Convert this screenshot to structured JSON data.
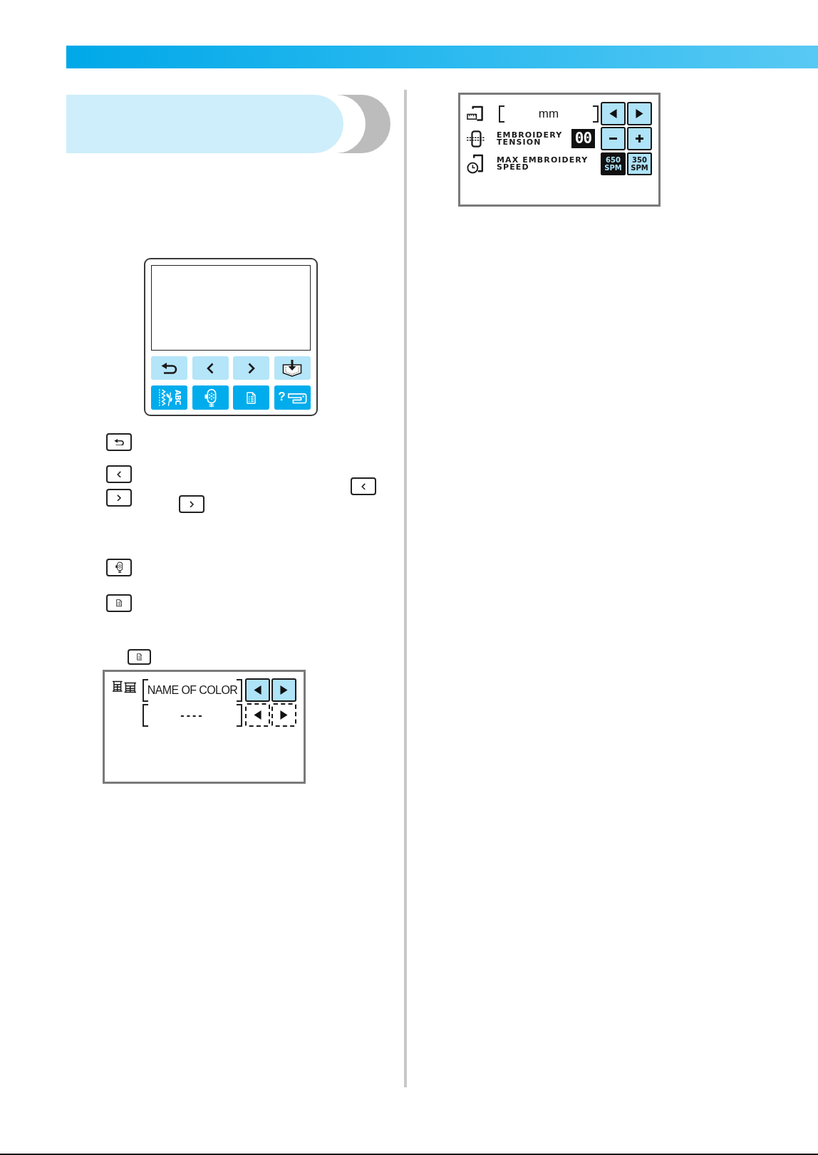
{
  "control_panel": {
    "key_rows": [
      [
        {
          "kind": "back"
        },
        {
          "kind": "prev"
        },
        {
          "kind": "next"
        },
        {
          "kind": "save"
        }
      ],
      [
        {
          "kind": "stitch",
          "label": "ABC"
        },
        {
          "kind": "embroidery"
        },
        {
          "kind": "list"
        },
        {
          "kind": "help",
          "label": "?"
        }
      ]
    ]
  },
  "key_legend": [
    {
      "keys": [
        {
          "kind": "back"
        }
      ]
    },
    {
      "keys": [
        {
          "kind": "prev"
        },
        {
          "kind": "next"
        }
      ],
      "inline_keys": [
        {
          "kind": "prev"
        },
        {
          "kind": "next"
        }
      ]
    },
    {
      "keys": [
        {
          "kind": "embroidery"
        }
      ]
    },
    {
      "keys": [
        {
          "kind": "list"
        }
      ]
    }
  ],
  "note": {
    "inline_keys": [
      {
        "kind": "list"
      }
    ]
  },
  "color_panel": {
    "rows": [
      {
        "value": "NAME OF COLOR",
        "disabled": false
      },
      {
        "value": "----",
        "disabled": true
      }
    ]
  },
  "settings_panel": {
    "rows": [
      {
        "kind": "length",
        "value": "mm"
      },
      {
        "kind": "tension",
        "label": "EMBROIDERY\nTENSION",
        "value": "00"
      },
      {
        "kind": "speed",
        "label": "MAX EMBROIDERY\nSPEED",
        "options": [
          {
            "label": "650\nSPM",
            "selected": true
          },
          {
            "label": "350\nSPM",
            "selected": false
          }
        ]
      }
    ]
  }
}
